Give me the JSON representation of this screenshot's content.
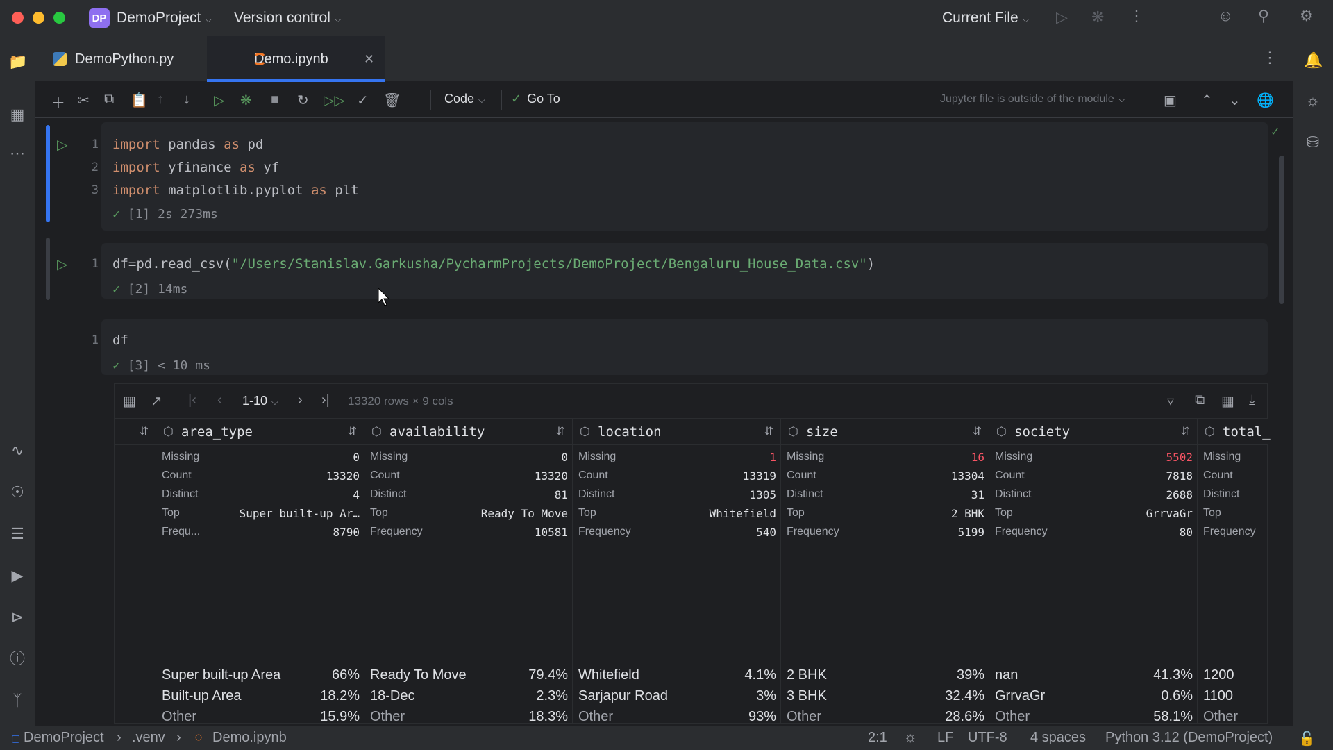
{
  "titlebar": {
    "project_badge": "DP",
    "project_name": "DemoProject",
    "version_control": "Version control",
    "run_config": "Current File"
  },
  "tabs": [
    {
      "label": "DemoPython.py",
      "active": false
    },
    {
      "label": "Demo.ipynb",
      "active": true
    }
  ],
  "toolbar": {
    "cell_type": "Code",
    "goto_label": "Go To",
    "jupyter_note": "Jupyter file is outside of the module"
  },
  "cells": [
    {
      "lines": [
        "1",
        "2",
        "3"
      ],
      "exec_count": "[1]",
      "exec_time": "2s 273ms"
    },
    {
      "lines": [
        "1"
      ],
      "prefix": "df=pd.read_csv(",
      "path": "\"/Users/Stanislav.Garkusha/PycharmProjects/DemoProject/Bengaluru_House_Data.csv\"",
      "suffix": ")",
      "exec_count": "[2]",
      "exec_time": "14ms"
    },
    {
      "lines": [
        "1"
      ],
      "code": "df",
      "exec_count": "[3]",
      "exec_time": "< 10 ms"
    }
  ],
  "dataframe": {
    "row_range": "1-10",
    "shape": "13320 rows × 9 cols",
    "columns": [
      {
        "name": "area_type",
        "stats": [
          [
            "Missing",
            "0"
          ],
          [
            "Count",
            "13320"
          ],
          [
            "Distinct",
            "4"
          ],
          [
            "Top",
            "Super built-up Ar…"
          ],
          [
            "Frequ...",
            "8790"
          ]
        ],
        "top_values": [
          [
            "Super built-up Area",
            "66%"
          ],
          [
            "Built-up Area",
            "18.2%"
          ],
          [
            "Other",
            "15.9%"
          ]
        ]
      },
      {
        "name": "availability",
        "stats": [
          [
            "Missing",
            "0"
          ],
          [
            "Count",
            "13320"
          ],
          [
            "Distinct",
            "81"
          ],
          [
            "Top",
            "Ready To Move"
          ],
          [
            "Frequency",
            "10581"
          ]
        ],
        "top_values": [
          [
            "Ready To Move",
            "79.4%"
          ],
          [
            "18-Dec",
            "2.3%"
          ],
          [
            "Other",
            "18.3%"
          ]
        ]
      },
      {
        "name": "location",
        "stats": [
          [
            "Missing",
            "1"
          ],
          [
            "Count",
            "13319"
          ],
          [
            "Distinct",
            "1305"
          ],
          [
            "Top",
            "Whitefield"
          ],
          [
            "Frequency",
            "540"
          ]
        ],
        "top_values": [
          [
            "Whitefield",
            "4.1%"
          ],
          [
            "Sarjapur Road",
            "3%"
          ],
          [
            "Other",
            "93%"
          ]
        ]
      },
      {
        "name": "size",
        "stats": [
          [
            "Missing",
            "16"
          ],
          [
            "Count",
            "13304"
          ],
          [
            "Distinct",
            "31"
          ],
          [
            "Top",
            "2 BHK"
          ],
          [
            "Frequency",
            "5199"
          ]
        ],
        "top_values": [
          [
            "2 BHK",
            "39%"
          ],
          [
            "3 BHK",
            "32.4%"
          ],
          [
            "Other",
            "28.6%"
          ]
        ]
      },
      {
        "name": "society",
        "stats": [
          [
            "Missing",
            "5502"
          ],
          [
            "Count",
            "7818"
          ],
          [
            "Distinct",
            "2688"
          ],
          [
            "Top",
            "GrrvaGr"
          ],
          [
            "Frequency",
            "80"
          ]
        ],
        "top_values": [
          [
            "nan",
            "41.3%"
          ],
          [
            "GrrvaGr",
            "0.6%"
          ],
          [
            "Other",
            "58.1%"
          ]
        ]
      },
      {
        "name": "total_",
        "stats": [
          [
            "Missing",
            ""
          ],
          [
            "Count",
            ""
          ],
          [
            "Distinct",
            ""
          ],
          [
            "Top",
            ""
          ],
          [
            "Frequency",
            ""
          ]
        ],
        "top_values": [
          [
            "1200",
            ""
          ],
          [
            "1100",
            ""
          ],
          [
            "Other",
            ""
          ]
        ]
      }
    ]
  },
  "statusbar": {
    "breadcrumb": [
      "DemoProject",
      ".venv",
      "Demo.ipynb"
    ],
    "position": "2:1",
    "line_sep": "LF",
    "encoding": "UTF-8",
    "indent": "4 spaces",
    "interpreter": "Python 3.12 (DemoProject)"
  }
}
